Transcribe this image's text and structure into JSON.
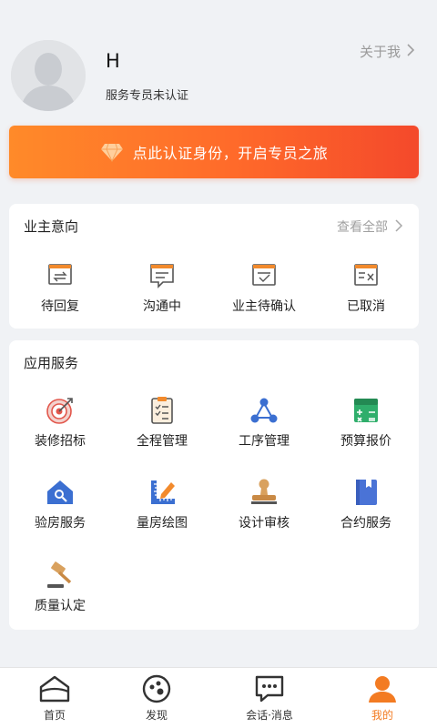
{
  "profile": {
    "name": "H",
    "status": "服务专员未认证",
    "about_label": "关于我"
  },
  "banner": {
    "text": "点此认证身份，开启专员之旅"
  },
  "owner_intent": {
    "title": "业主意向",
    "view_all": "查看全部",
    "items": [
      {
        "label": "待回复",
        "icon": "reply-doc-icon"
      },
      {
        "label": "沟通中",
        "icon": "chat-doc-icon"
      },
      {
        "label": "业主待确认",
        "icon": "confirm-doc-icon"
      },
      {
        "label": "已取消",
        "icon": "cancel-doc-icon"
      }
    ]
  },
  "app_services": {
    "title": "应用服务",
    "items": [
      {
        "label": "装修招标",
        "icon": "target-icon"
      },
      {
        "label": "全程管理",
        "icon": "checklist-icon"
      },
      {
        "label": "工序管理",
        "icon": "process-nodes-icon"
      },
      {
        "label": "预算报价",
        "icon": "calculator-icon"
      },
      {
        "label": "验房服务",
        "icon": "house-search-icon"
      },
      {
        "label": "量房绘图",
        "icon": "ruler-pencil-icon"
      },
      {
        "label": "设计审核",
        "icon": "stamp-icon"
      },
      {
        "label": "合约服务",
        "icon": "contract-book-icon"
      },
      {
        "label": "质量认定",
        "icon": "gavel-icon"
      }
    ]
  },
  "tabbar": {
    "items": [
      {
        "label": "首页",
        "icon": "home-icon",
        "active": false
      },
      {
        "label": "发现",
        "icon": "discover-icon",
        "active": false
      },
      {
        "label": "会话·消息",
        "icon": "message-icon",
        "active": false
      },
      {
        "label": "我的",
        "icon": "profile-icon",
        "active": true
      }
    ]
  },
  "colors": {
    "accent": "#f37b22",
    "banner_start": "#ff8a29",
    "banner_end": "#f4492b",
    "icon_blue": "#3b6fd1",
    "icon_orange": "#f28a2c"
  }
}
